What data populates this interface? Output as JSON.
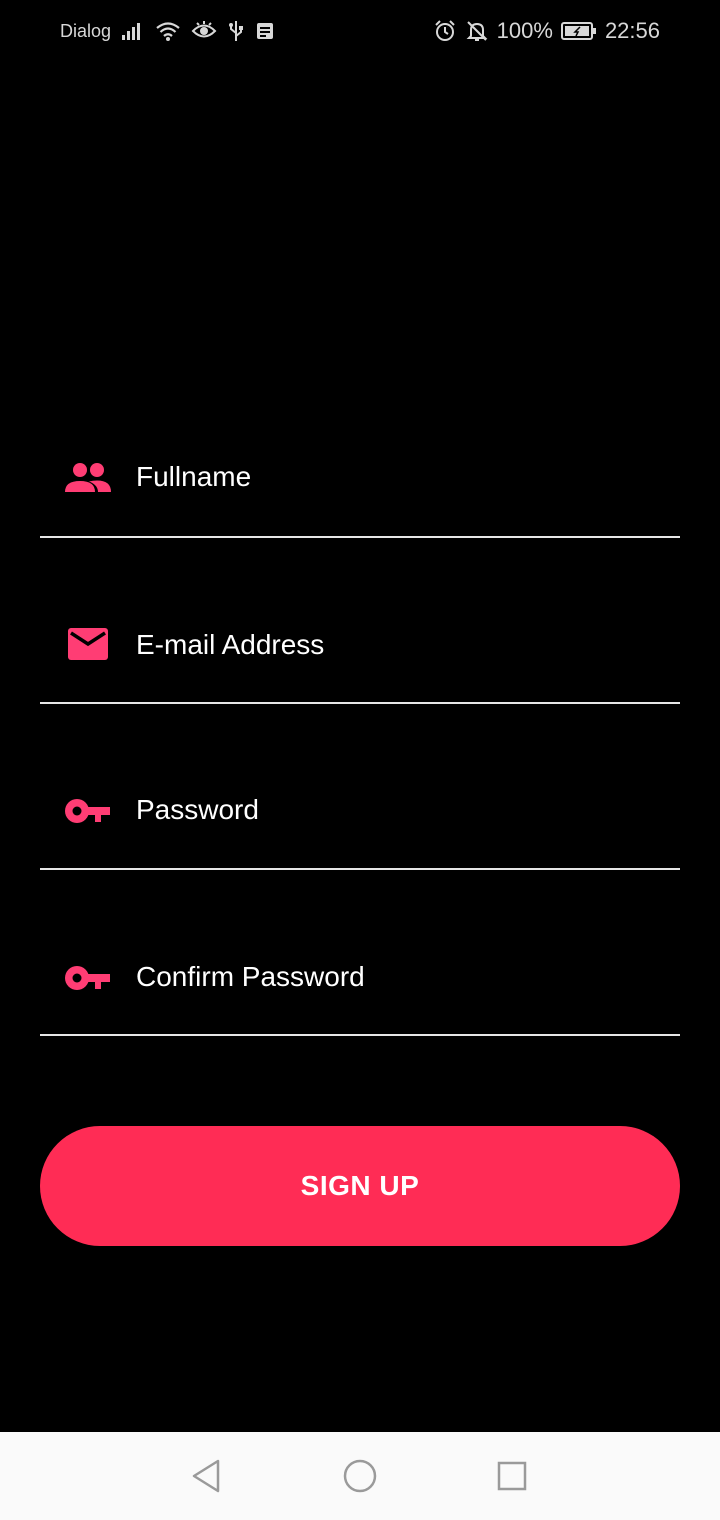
{
  "status_bar": {
    "carrier": "Dialog",
    "battery": "100%",
    "time": "22:56"
  },
  "form": {
    "fullname": {
      "placeholder": "Fullname",
      "value": "",
      "icon": "people-icon"
    },
    "email": {
      "placeholder": "E-mail Address",
      "value": "",
      "icon": "mail-icon"
    },
    "password": {
      "placeholder": "Password",
      "value": "",
      "icon": "key-icon"
    },
    "confirm_password": {
      "placeholder": "Confirm Password",
      "value": "",
      "icon": "key-icon"
    }
  },
  "signup_button": {
    "label": "SIGN UP"
  },
  "colors": {
    "accent": "#ff2c55",
    "icon_pink": "#ff3d74",
    "background": "#000000",
    "divider": "#e6e6e6",
    "nav_bar": "#fafafa"
  },
  "nav_bar": {
    "back": "back-triangle-icon",
    "home": "home-circle-icon",
    "recents": "recents-square-icon"
  }
}
